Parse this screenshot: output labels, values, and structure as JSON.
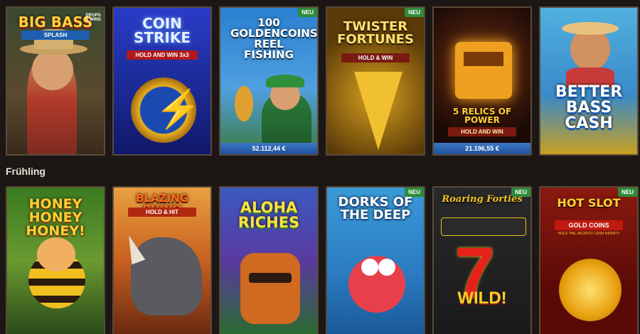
{
  "section": {
    "title": "Frühling"
  },
  "badge_label": "NEU",
  "row1": [
    {
      "title": "BIG BASS",
      "subtitle": "SPLASH",
      "extra": "DROPS & WINS",
      "badge": false,
      "jackpot": ""
    },
    {
      "title": "COIN STRIKE",
      "subtitle": "HOLD AND WIN 3x3",
      "badge": false,
      "jackpot": ""
    },
    {
      "title": "100 GOLDENCOINS REEL FISHING",
      "badge": true,
      "jackpot": "52.112,44 €"
    },
    {
      "title": "TWISTER FORTUNES",
      "subtitle": "HOLD & WIN",
      "badge": true,
      "jackpot": ""
    },
    {
      "title": "5 RELICS OF POWER",
      "subtitle": "HOLD AND WIN",
      "badge": false,
      "jackpot": "21.196,55 €"
    },
    {
      "title": "BETTER BASS CASH",
      "badge": false,
      "jackpot": ""
    }
  ],
  "row2": [
    {
      "title": "HONEY HONEY HONEY!",
      "badge": false
    },
    {
      "title": "BLAZING RHINO",
      "subtitle": "HOLD & HIT",
      "badge": false
    },
    {
      "title": "ALOHA RICHES",
      "badge": false
    },
    {
      "title": "DORKS OF THE DEEP",
      "badge": true
    },
    {
      "title": "Roaring Forties",
      "subtitle": "WILD!",
      "badge": true
    },
    {
      "title": "HOT SLOT",
      "subtitle": "GOLD COINS",
      "extra": "HOLD THE JACKPOT CASH INFINITY",
      "badge": true
    }
  ]
}
